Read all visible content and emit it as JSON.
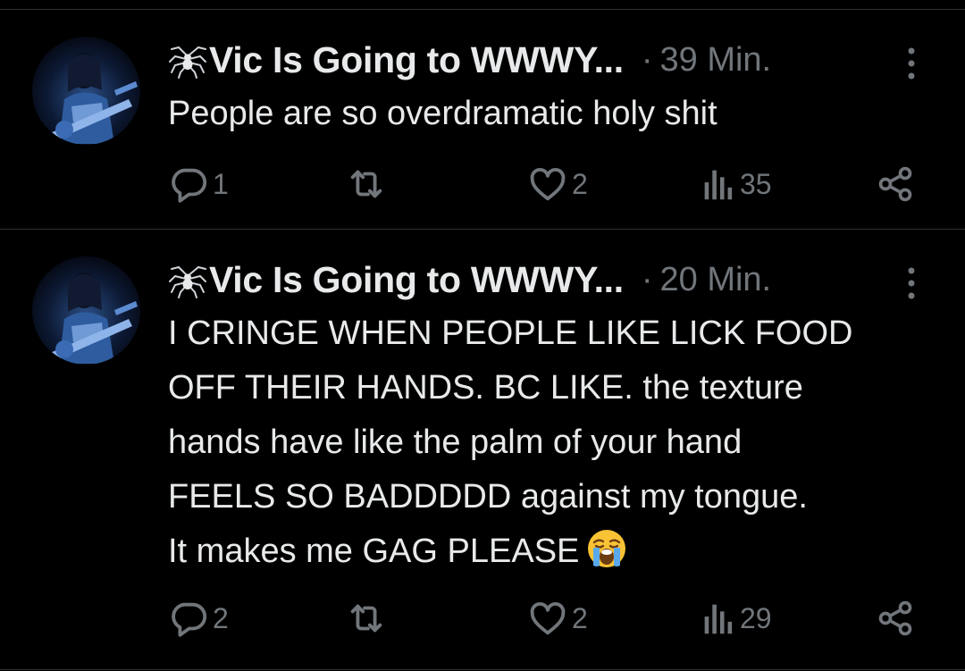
{
  "tweets": [
    {
      "display_name": "Vic Is Going to WWWY...",
      "separator": "·",
      "timestamp": "39 Min.",
      "text_lines": [
        "People are so overdramatic holy shit"
      ],
      "replies": "1",
      "retweets": "",
      "likes": "2",
      "views": "35"
    },
    {
      "display_name": "Vic Is Going to WWWY...",
      "separator": "·",
      "timestamp": "20 Min.",
      "text_lines": [
        "I CRINGE WHEN PEOPLE LIKE LICK FOOD",
        "OFF THEIR HANDS. BC LIKE. the texture",
        "hands have like the palm of your hand",
        "FEELS SO BADDDDD against my tongue.",
        "It makes me GAG PLEASE"
      ],
      "emoji": "loudly-crying-face",
      "replies": "2",
      "retweets": "",
      "likes": "2",
      "views": "29"
    }
  ],
  "icons": {
    "name_prefix": "spider-icon",
    "more": "more-options-icon",
    "reply": "reply-icon",
    "retweet": "retweet-icon",
    "like": "heart-icon",
    "views": "views-icon",
    "share": "share-icon"
  },
  "colors": {
    "background": "#000000",
    "primary_text": "#e7e9ea",
    "secondary_text": "#71767b",
    "divider": "#2f3336"
  }
}
